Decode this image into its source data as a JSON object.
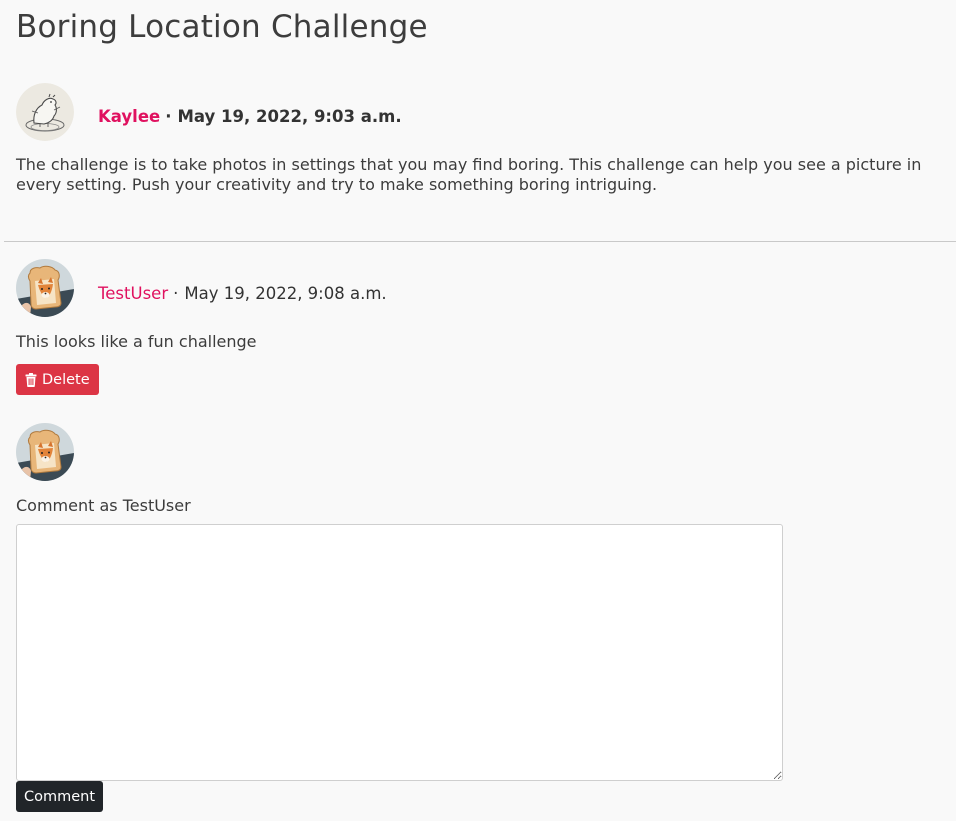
{
  "page": {
    "title": "Boring Location Challenge"
  },
  "post": {
    "author": "Kaylee",
    "separator": "·",
    "date": "May 19, 2022, 9:03 a.m.",
    "body": "The challenge is to take photos in settings that you may find boring. This challenge can help you see a picture in every setting. Push your creativity and try to make something boring intriguing."
  },
  "comments": [
    {
      "author": "TestUser",
      "separator": "·",
      "date": "May 19, 2022, 9:08 a.m.",
      "body": "This looks like a fun challenge",
      "delete_label": "Delete"
    }
  ],
  "comment_form": {
    "label": "Comment as TestUser",
    "value": "",
    "submit_label": "Comment"
  },
  "colors": {
    "author_link": "#e0115f",
    "delete_button": "#dc3545",
    "comment_button": "#212529",
    "background": "#f9f9f9"
  },
  "icons": {
    "delete": "trash-icon"
  }
}
